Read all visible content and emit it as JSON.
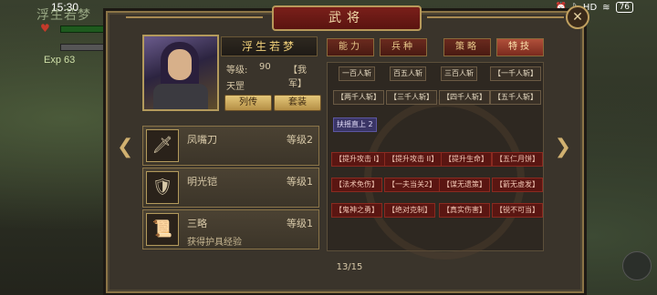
{
  "status": {
    "time": "15:30",
    "battery": "76"
  },
  "hud": {
    "name": "浮生若梦",
    "exp_label": "Exp",
    "exp_value": "63",
    "side_char": "兵"
  },
  "dialog": {
    "title": "武将",
    "page": "13/15"
  },
  "hero": {
    "name": "浮生若梦",
    "level_label": "等级:",
    "level": "90",
    "faction": "【我军】",
    "title": "天罡",
    "btn_biography": "列传",
    "btn_suit": "套装"
  },
  "equipment": [
    {
      "name": "凤嘴刀",
      "level": "等级2",
      "desc": ""
    },
    {
      "name": "明光铠",
      "level": "等级1",
      "desc": ""
    },
    {
      "name": "三略",
      "level": "等级1",
      "desc": "获得护具经验"
    }
  ],
  "tabs": [
    "能力",
    "兵种",
    "策略",
    "特技"
  ],
  "skills_row1": [
    "一百人斩",
    "百五人斩",
    "三百人斩",
    "【一千人斩】"
  ],
  "skills_row2": [
    "【两千人斩】",
    "【三千人斩】",
    "【四千人斩】",
    "【五千人斩】"
  ],
  "skills_row3": [
    "扶摇直上 2"
  ],
  "skills_row4": [
    "【提升攻击 I】",
    "【提升攻击 II】",
    "【提升生命】",
    "【五仁月饼】"
  ],
  "skills_row5": [
    "【法术免伤】",
    "【一夫当关2】",
    "【谋无遗策】",
    "【箭无虚发】"
  ],
  "skills_row6": [
    "【鬼神之勇】",
    "【绝对克制】",
    "【真实伤害】",
    "【锐不可当】"
  ]
}
